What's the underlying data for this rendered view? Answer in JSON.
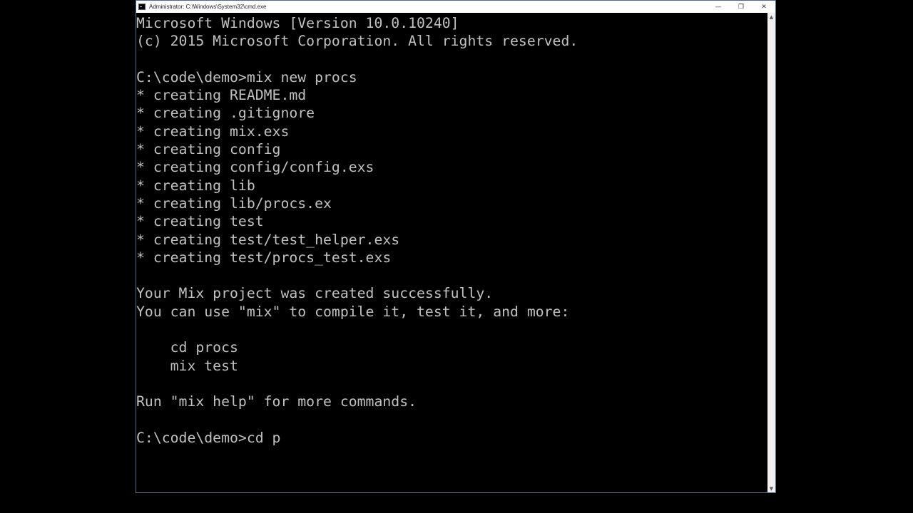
{
  "window": {
    "title": "Administrator: C:\\Windows\\System32\\cmd.exe",
    "controls": {
      "minimize": "—",
      "restore": "❐",
      "close": "✕"
    }
  },
  "console": {
    "lines": [
      "Microsoft Windows [Version 10.0.10240]",
      "(c) 2015 Microsoft Corporation. All rights reserved.",
      "",
      "C:\\code\\demo>mix new procs",
      "* creating README.md",
      "* creating .gitignore",
      "* creating mix.exs",
      "* creating config",
      "* creating config/config.exs",
      "* creating lib",
      "* creating lib/procs.ex",
      "* creating test",
      "* creating test/test_helper.exs",
      "* creating test/procs_test.exs",
      "",
      "Your Mix project was created successfully.",
      "You can use \"mix\" to compile it, test it, and more:",
      "",
      "    cd procs",
      "    mix test",
      "",
      "Run \"mix help\" for more commands.",
      "",
      "C:\\code\\demo>cd p"
    ]
  },
  "scrollbar": {
    "up_arrow": "▲",
    "down_arrow": "▼"
  }
}
